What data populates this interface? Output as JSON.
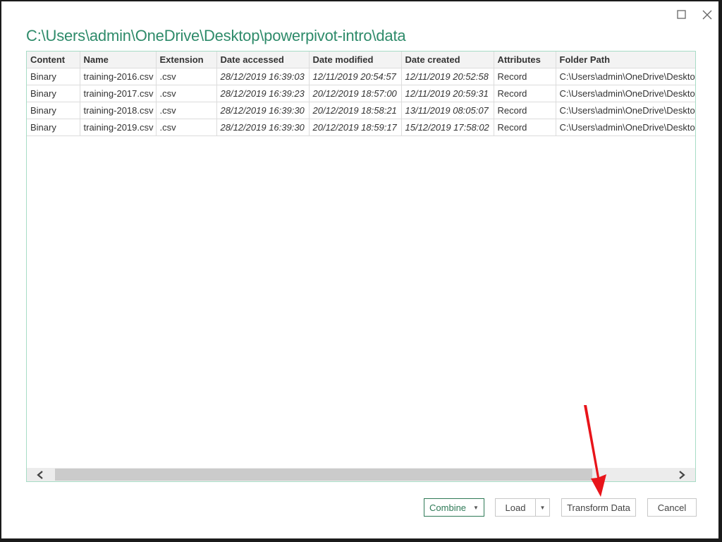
{
  "window": {
    "title": "C:\\Users\\admin\\OneDrive\\Desktop\\powerpivot-intro\\data",
    "controls": {
      "maximize_icon": "maximize-icon",
      "close_icon": "close-icon"
    }
  },
  "table": {
    "columns": [
      "Content",
      "Name",
      "Extension",
      "Date accessed",
      "Date modified",
      "Date created",
      "Attributes",
      "Folder Path"
    ],
    "rows": [
      {
        "content": "Binary",
        "name": "training-2016.csv",
        "extension": ".csv",
        "date_accessed": "28/12/2019 16:39:03",
        "date_modified": "12/11/2019 20:54:57",
        "date_created": "12/11/2019 20:52:58",
        "attributes": "Record",
        "folder_path": "C:\\Users\\admin\\OneDrive\\Desktop"
      },
      {
        "content": "Binary",
        "name": "training-2017.csv",
        "extension": ".csv",
        "date_accessed": "28/12/2019 16:39:23",
        "date_modified": "20/12/2019 18:57:00",
        "date_created": "12/11/2019 20:59:31",
        "attributes": "Record",
        "folder_path": "C:\\Users\\admin\\OneDrive\\Desktop"
      },
      {
        "content": "Binary",
        "name": "training-2018.csv",
        "extension": ".csv",
        "date_accessed": "28/12/2019 16:39:30",
        "date_modified": "20/12/2019 18:58:21",
        "date_created": "13/11/2019 08:05:07",
        "attributes": "Record",
        "folder_path": "C:\\Users\\admin\\OneDrive\\Desktop"
      },
      {
        "content": "Binary",
        "name": "training-2019.csv",
        "extension": ".csv",
        "date_accessed": "28/12/2019 16:39:30",
        "date_modified": "20/12/2019 18:59:17",
        "date_created": "15/12/2019 17:58:02",
        "attributes": "Record",
        "folder_path": "C:\\Users\\admin\\OneDrive\\Desktop"
      }
    ]
  },
  "scrollbar": {
    "left_icon": "chevron-left-icon",
    "right_icon": "chevron-right-icon"
  },
  "buttons": {
    "combine": "Combine",
    "load": "Load",
    "transform_data": "Transform Data",
    "cancel": "Cancel"
  },
  "colors": {
    "accent": "#2f7a57",
    "title": "#2e8b6a",
    "grid_border": "#a8dcc6",
    "annotation_arrow": "#e8141a"
  }
}
